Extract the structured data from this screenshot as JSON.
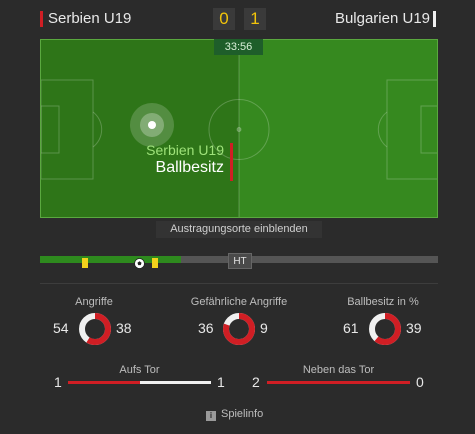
{
  "match": {
    "home_team": "Serbien U19",
    "away_team": "Bulgarien U19",
    "home_score": "0",
    "away_score": "1",
    "clock": "33:56"
  },
  "possession": {
    "team": "Serbien U19",
    "label": "Ballbesitz"
  },
  "venue_button": "Austragungsorte einblenden",
  "timeline": {
    "half_label": "HT",
    "progress_fraction": 0.355
  },
  "stats": [
    {
      "title": "Angriffe",
      "home": "54",
      "away": "38",
      "home_share": 0.587
    },
    {
      "title": "Gefährliche Angriffe",
      "home": "36",
      "away": "9",
      "home_share": 0.8
    },
    {
      "title": "Ballbesitz in %",
      "home": "61",
      "away": "39",
      "home_share": 0.61
    }
  ],
  "bars": [
    {
      "title": "Aufs Tor",
      "home": "1",
      "away": "1",
      "home_share": 0.5
    },
    {
      "title": "Neben das Tor",
      "home": "2",
      "away": "0",
      "home_share": 1.0
    }
  ],
  "footer": {
    "info_label": "Spielinfo",
    "info_icon": "info-icon"
  },
  "colors": {
    "home": "#d01e24",
    "away": "#f0f0f0",
    "score": "#f2c40a",
    "pitch": "#36891f",
    "possession_text": "#9ee27a"
  }
}
